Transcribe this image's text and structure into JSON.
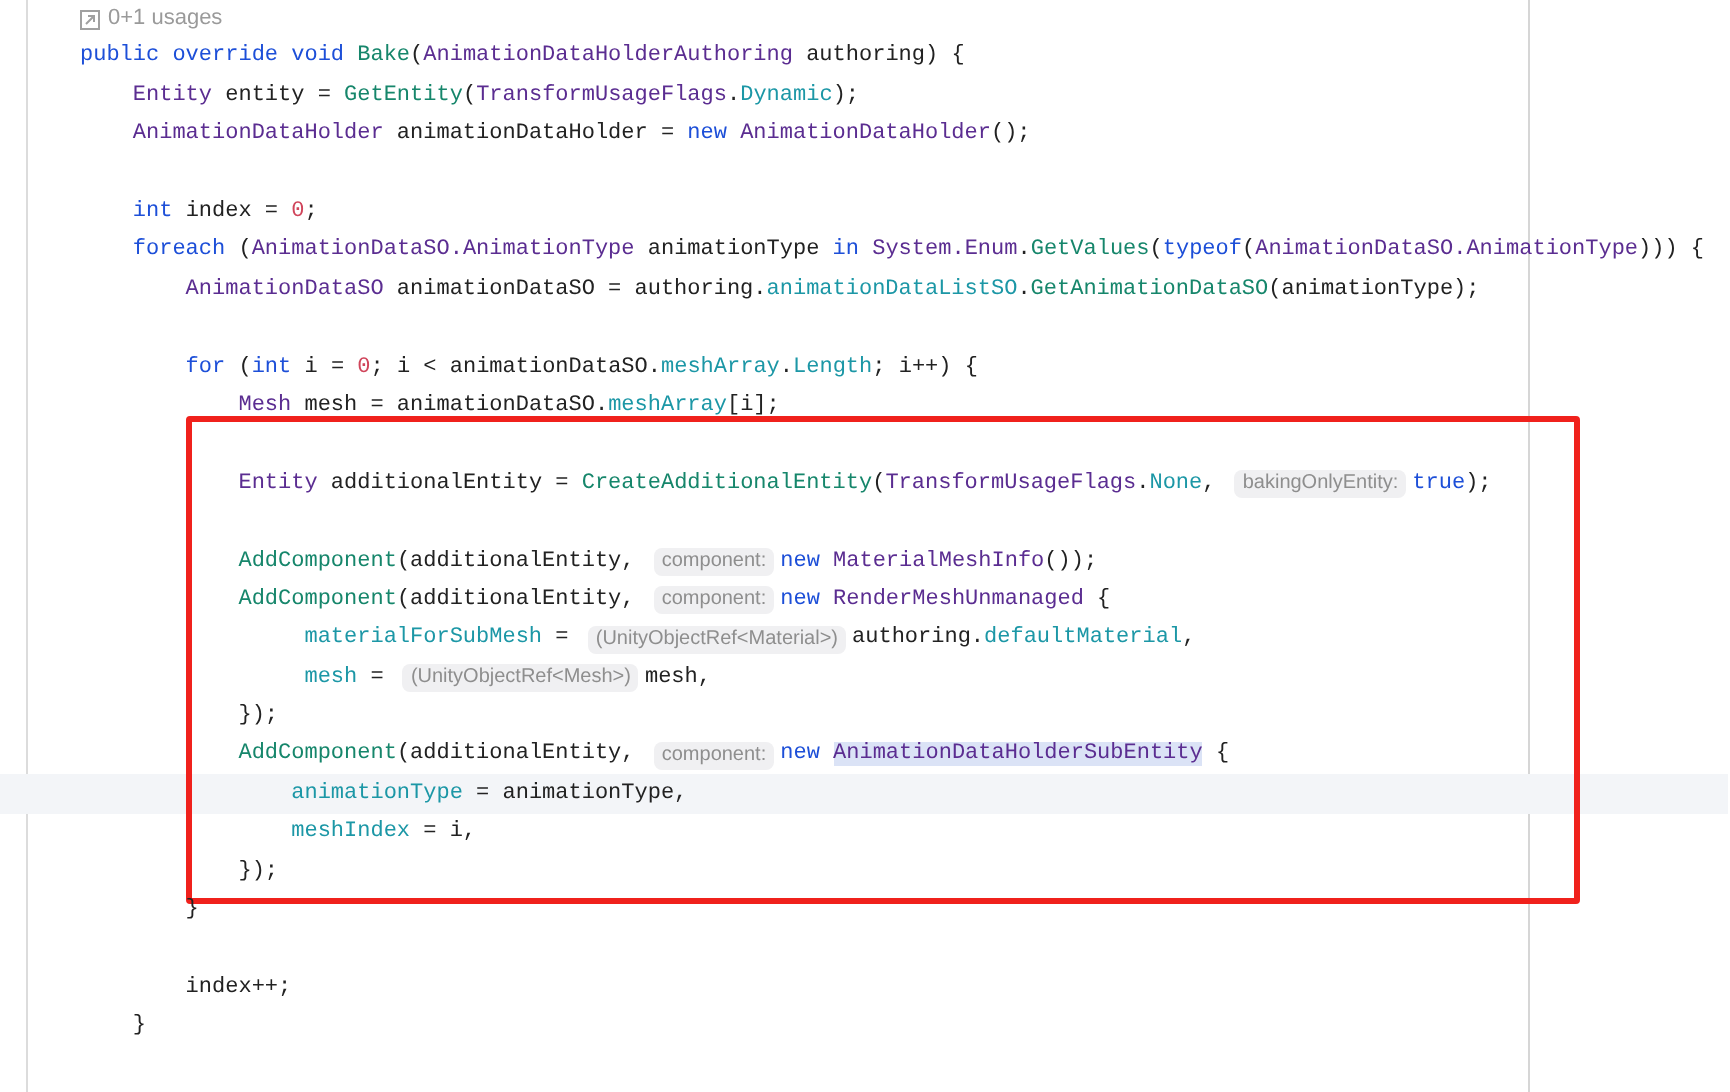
{
  "usages": {
    "text": "0+1 usages"
  },
  "sections": [
    {
      "boxed": false,
      "lines": [
        {
          "kind": "code",
          "current": false,
          "tokens": [
            {
              "text": "public override void ",
              "kind": "kw"
            },
            {
              "text": "Bake",
              "kind": "method"
            },
            {
              "text": "(",
              "kind": "plain"
            },
            {
              "text": "AnimationDataHolderAuthoring",
              "kind": "type"
            },
            {
              "text": " authoring) {",
              "kind": "plain"
            }
          ]
        },
        {
          "kind": "code",
          "current": false,
          "tokens": [
            {
              "text": "    Entity",
              "kind": "type"
            },
            {
              "text": " entity = ",
              "kind": "plain"
            },
            {
              "text": "GetEntity",
              "kind": "method"
            },
            {
              "text": "(",
              "kind": "plain"
            },
            {
              "text": "TransformUsageFlags",
              "kind": "type"
            },
            {
              "text": ".",
              "kind": "plain"
            },
            {
              "text": "Dynamic",
              "kind": "field"
            },
            {
              "text": ");",
              "kind": "plain"
            }
          ]
        },
        {
          "kind": "code",
          "current": false,
          "tokens": [
            {
              "text": "    AnimationDataHolder",
              "kind": "type"
            },
            {
              "text": " animationDataHolder = ",
              "kind": "plain"
            },
            {
              "text": "new ",
              "kind": "kw"
            },
            {
              "text": "AnimationDataHolder",
              "kind": "type"
            },
            {
              "text": "();",
              "kind": "plain"
            }
          ]
        },
        {
          "kind": "blank"
        },
        {
          "kind": "code",
          "current": false,
          "tokens": [
            {
              "text": "    int",
              "kind": "kw"
            },
            {
              "text": " index = ",
              "kind": "plain"
            },
            {
              "text": "0",
              "kind": "num"
            },
            {
              "text": ";",
              "kind": "plain"
            }
          ]
        },
        {
          "kind": "code",
          "current": false,
          "tokens": [
            {
              "text": "    foreach",
              "kind": "kw"
            },
            {
              "text": " (",
              "kind": "plain"
            },
            {
              "text": "AnimationDataSO.AnimationType",
              "kind": "type"
            },
            {
              "text": " animationType ",
              "kind": "plain"
            },
            {
              "text": "in ",
              "kind": "kw"
            },
            {
              "text": "System.Enum",
              "kind": "type"
            },
            {
              "text": ".",
              "kind": "plain"
            },
            {
              "text": "GetValues",
              "kind": "method"
            },
            {
              "text": "(",
              "kind": "plain"
            },
            {
              "text": "typeof",
              "kind": "kw"
            },
            {
              "text": "(",
              "kind": "plain"
            },
            {
              "text": "AnimationDataSO.AnimationType",
              "kind": "type"
            },
            {
              "text": "))) {",
              "kind": "plain"
            }
          ]
        },
        {
          "kind": "code",
          "current": false,
          "tokens": [
            {
              "text": "        AnimationDataSO",
              "kind": "type"
            },
            {
              "text": " animationDataSO = authoring.",
              "kind": "plain"
            },
            {
              "text": "animationDataListSO",
              "kind": "field"
            },
            {
              "text": ".",
              "kind": "plain"
            },
            {
              "text": "GetAnimationDataSO",
              "kind": "method"
            },
            {
              "text": "(animationType);",
              "kind": "plain"
            }
          ]
        },
        {
          "kind": "blank"
        },
        {
          "kind": "code",
          "current": false,
          "tokens": [
            {
              "text": "        for",
              "kind": "kw"
            },
            {
              "text": " (",
              "kind": "plain"
            },
            {
              "text": "int",
              "kind": "kw"
            },
            {
              "text": " i = ",
              "kind": "plain"
            },
            {
              "text": "0",
              "kind": "num"
            },
            {
              "text": "; i < animationDataSO.",
              "kind": "plain"
            },
            {
              "text": "meshArray",
              "kind": "field"
            },
            {
              "text": ".",
              "kind": "plain"
            },
            {
              "text": "Length",
              "kind": "field"
            },
            {
              "text": "; i++) {",
              "kind": "plain"
            }
          ]
        },
        {
          "kind": "code",
          "current": false,
          "tokens": [
            {
              "text": "            Mesh",
              "kind": "type"
            },
            {
              "text": " mesh = animationDataSO.",
              "kind": "plain"
            },
            {
              "text": "meshArray",
              "kind": "field"
            },
            {
              "text": "[i];",
              "kind": "plain"
            }
          ]
        }
      ]
    },
    {
      "boxed": true,
      "lines": [
        {
          "kind": "blank"
        },
        {
          "kind": "code",
          "current": false,
          "tokens": [
            {
              "text": "            Entity",
              "kind": "type"
            },
            {
              "text": " additionalEntity = ",
              "kind": "plain"
            },
            {
              "text": "CreateAdditionalEntity",
              "kind": "method"
            },
            {
              "text": "(",
              "kind": "plain"
            },
            {
              "text": "TransformUsageFlags",
              "kind": "type"
            },
            {
              "text": ".",
              "kind": "plain"
            },
            {
              "text": "None",
              "kind": "field"
            },
            {
              "text": ", ",
              "kind": "plain"
            },
            {
              "text": "bakingOnlyEntity:",
              "kind": "hint"
            },
            {
              "text": "true",
              "kind": "kw"
            },
            {
              "text": ");",
              "kind": "plain"
            }
          ]
        },
        {
          "kind": "blank"
        },
        {
          "kind": "code",
          "current": false,
          "tokens": [
            {
              "text": "            AddComponent",
              "kind": "method"
            },
            {
              "text": "(additionalEntity, ",
              "kind": "plain"
            },
            {
              "text": "component:",
              "kind": "hint"
            },
            {
              "text": "new ",
              "kind": "kw"
            },
            {
              "text": "MaterialMeshInfo",
              "kind": "type"
            },
            {
              "text": "());",
              "kind": "plain"
            }
          ]
        },
        {
          "kind": "code",
          "current": false,
          "tokens": [
            {
              "text": "            AddComponent",
              "kind": "method"
            },
            {
              "text": "(additionalEntity, ",
              "kind": "plain"
            },
            {
              "text": "component:",
              "kind": "hint"
            },
            {
              "text": "new ",
              "kind": "kw"
            },
            {
              "text": "RenderMeshUnmanaged",
              "kind": "type"
            },
            {
              "text": " {",
              "kind": "plain"
            }
          ]
        },
        {
          "kind": "code",
          "current": false,
          "tokens": [
            {
              "text": "                 materialForSubMesh",
              "kind": "field"
            },
            {
              "text": " = ",
              "kind": "plain"
            },
            {
              "text": "(UnityObjectRef<Material>)",
              "kind": "hint"
            },
            {
              "text": "authoring.",
              "kind": "plain"
            },
            {
              "text": "defaultMaterial",
              "kind": "field"
            },
            {
              "text": ",",
              "kind": "plain"
            }
          ]
        },
        {
          "kind": "code",
          "current": false,
          "tokens": [
            {
              "text": "                 mesh",
              "kind": "field"
            },
            {
              "text": " = ",
              "kind": "plain"
            },
            {
              "text": "(UnityObjectRef<Mesh>)",
              "kind": "hint"
            },
            {
              "text": "mesh,",
              "kind": "plain"
            }
          ]
        },
        {
          "kind": "code",
          "current": false,
          "tokens": [
            {
              "text": "            });",
              "kind": "plain"
            }
          ]
        },
        {
          "kind": "code",
          "current": false,
          "tokens": [
            {
              "text": "            AddComponent",
              "kind": "method"
            },
            {
              "text": "(additionalEntity, ",
              "kind": "plain"
            },
            {
              "text": "component:",
              "kind": "hint"
            },
            {
              "text": "new ",
              "kind": "kw"
            },
            {
              "text": "AnimationDataHolderSubEntity",
              "kind": "sel"
            },
            {
              "text": " {",
              "kind": "plain"
            }
          ]
        },
        {
          "kind": "code",
          "current": true,
          "tokens": [
            {
              "text": "                animationType",
              "kind": "field"
            },
            {
              "text": " = animationType,",
              "kind": "plain"
            }
          ]
        },
        {
          "kind": "code",
          "current": false,
          "tokens": [
            {
              "text": "                meshIndex",
              "kind": "field"
            },
            {
              "text": " = i,",
              "kind": "plain"
            }
          ]
        },
        {
          "kind": "code",
          "current": false,
          "tokens": [
            {
              "text": "            });",
              "kind": "plain"
            }
          ]
        }
      ]
    },
    {
      "boxed": false,
      "lines": [
        {
          "kind": "code",
          "current": false,
          "tokens": [
            {
              "text": "        }",
              "kind": "plain"
            }
          ]
        },
        {
          "kind": "blank"
        },
        {
          "kind": "code",
          "current": false,
          "tokens": [
            {
              "text": "        index++;",
              "kind": "plain"
            }
          ]
        },
        {
          "kind": "code",
          "current": false,
          "tokens": [
            {
              "text": "    }",
              "kind": "plain"
            }
          ]
        }
      ]
    }
  ]
}
